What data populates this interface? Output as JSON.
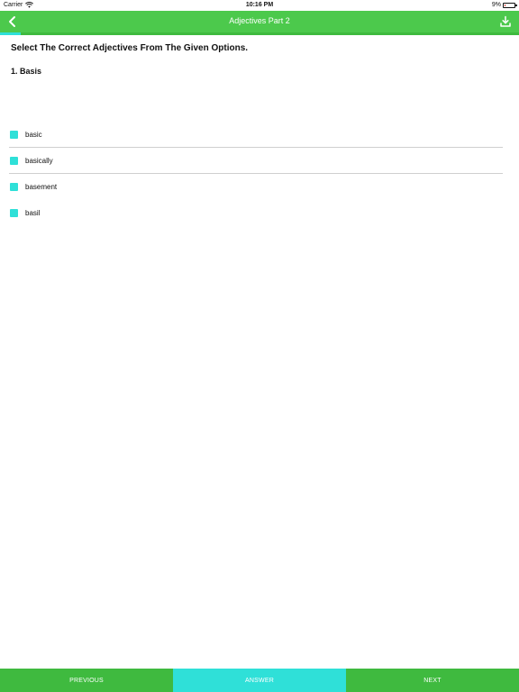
{
  "status_bar": {
    "carrier": "Carrier",
    "time": "10:16 PM",
    "battery_percent": "9%",
    "battery_level": 0.09,
    "wifi_icon": "wifi-icon",
    "battery_icon": "battery-icon"
  },
  "nav": {
    "title": "Adjectives Part 2",
    "back_icon": "chevron-left-icon",
    "download_icon": "download-icon"
  },
  "progress": {
    "fraction": 0.04
  },
  "quiz": {
    "instruction": "Select The Correct Adjectives From The Given Options.",
    "question": "1. Basis",
    "options": [
      {
        "label": "basic"
      },
      {
        "label": "basically"
      },
      {
        "label": "basement"
      },
      {
        "label": "basil"
      }
    ]
  },
  "footer": {
    "previous_label": "PREVIOUS",
    "answer_label": "ANSWER",
    "next_label": "NEXT"
  },
  "colors": {
    "primary_green": "#4cc94c",
    "button_green": "#3fba3f",
    "accent_cyan": "#2fe0d8"
  }
}
